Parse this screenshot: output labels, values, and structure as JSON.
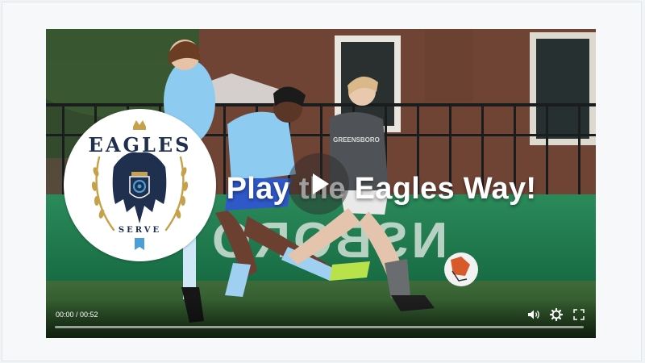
{
  "video": {
    "headline": "Play the Eagles Way!",
    "time_display": "00:00 / 00:52",
    "progress": 0
  },
  "logo": {
    "wordmark": "EAGLES",
    "tagline": "SERVE"
  },
  "controls": {
    "volume_icon": "volume-icon",
    "settings_icon": "gear-icon",
    "fullscreen_icon": "fullscreen-icon"
  },
  "colors": {
    "logo_navy": "#1f2f4e",
    "logo_gold": "#c7a14a",
    "logo_blue": "#4a9fd8",
    "banner_green": "#1e7a4e",
    "jersey_light_blue": "#8ecbf0",
    "jersey_gray": "#4f5256"
  }
}
